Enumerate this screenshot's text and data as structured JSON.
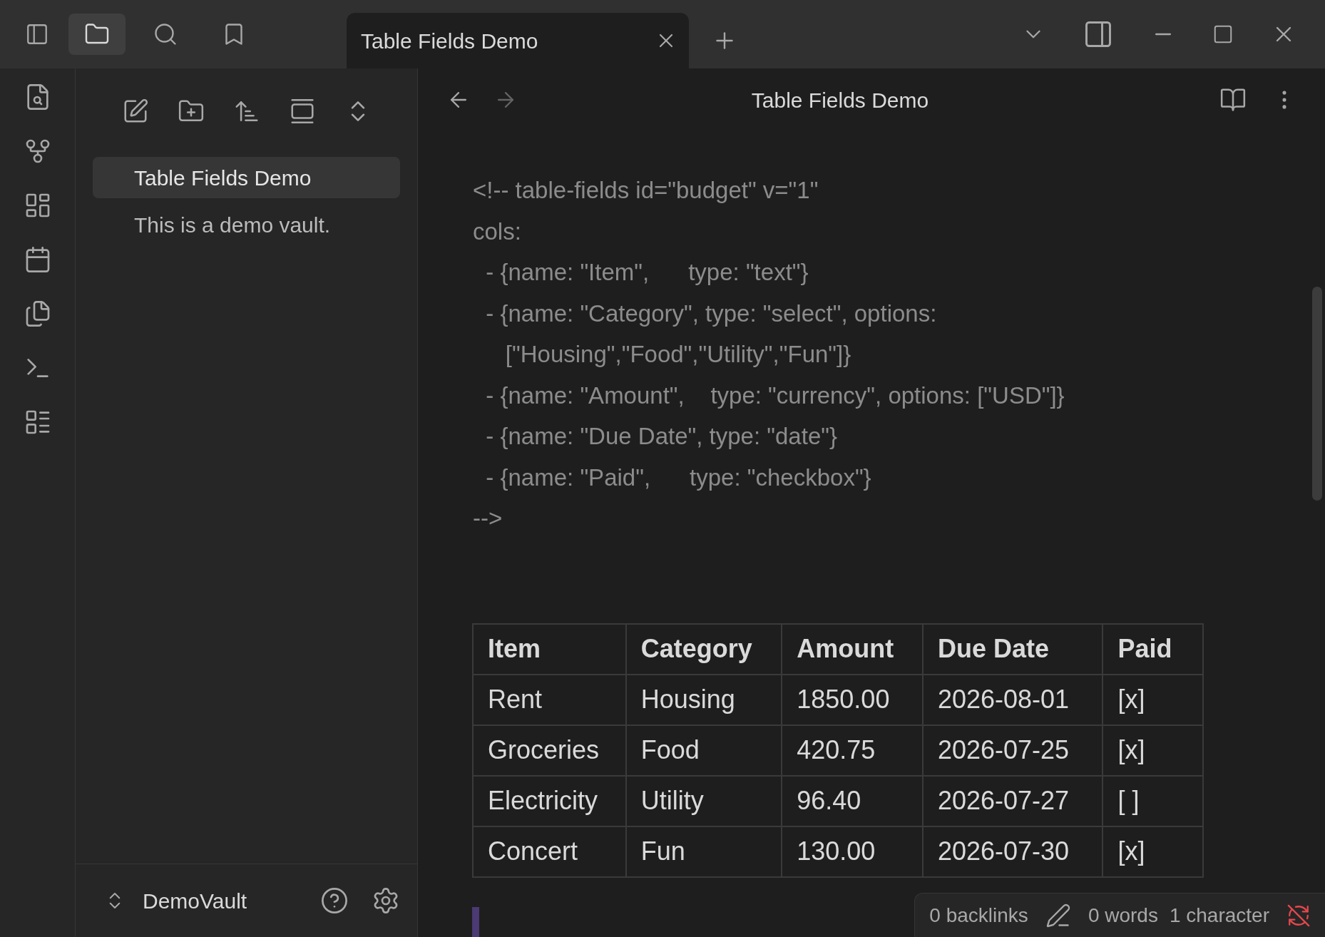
{
  "header_tabs": [
    {
      "kind": "files",
      "selected": true
    },
    {
      "kind": "search",
      "selected": false
    },
    {
      "kind": "bookmarks",
      "selected": false
    }
  ],
  "tabs": [
    {
      "label": "Table Fields Demo",
      "selected": true
    }
  ],
  "note_title": "Table Fields Demo",
  "sidebar": {
    "items": [
      {
        "label": "Table Fields Demo",
        "selected": true
      },
      {
        "label": "This is a demo vault.",
        "selected": false
      }
    ],
    "vault": "DemoVault"
  },
  "code_lines": [
    "<!-- table-fields id=\"budget\" v=\"1\"",
    "cols:",
    "  - {name: \"Item\",      type: \"text\"}",
    "  - {name: \"Category\", type: \"select\", options:",
    "     [\"Housing\",\"Food\",\"Utility\",\"Fun\"]}",
    "  - {name: \"Amount\",    type: \"currency\", options: [\"USD\"]}",
    "  - {name: \"Due Date\", type: \"date\"}",
    "  - {name: \"Paid\",      type: \"checkbox\"}",
    "-->"
  ],
  "table": {
    "columns": [
      "Item",
      "Category",
      "Amount",
      "Due Date",
      "Paid"
    ],
    "rows": [
      [
        "Rent",
        "Housing",
        "1850.00",
        "2026-08-01",
        "[x]"
      ],
      [
        "Groceries",
        "Food",
        "420.75",
        "2026-07-25",
        "[x]"
      ],
      [
        "Electricity",
        "Utility",
        "96.40",
        "2026-07-27",
        "[ ]"
      ],
      [
        "Concert",
        "Fun",
        "130.00",
        "2026-07-30",
        "[x]"
      ]
    ]
  },
  "status_bar": {
    "backlinks": "0 backlinks",
    "words": "0 words",
    "characters": "1 character"
  }
}
